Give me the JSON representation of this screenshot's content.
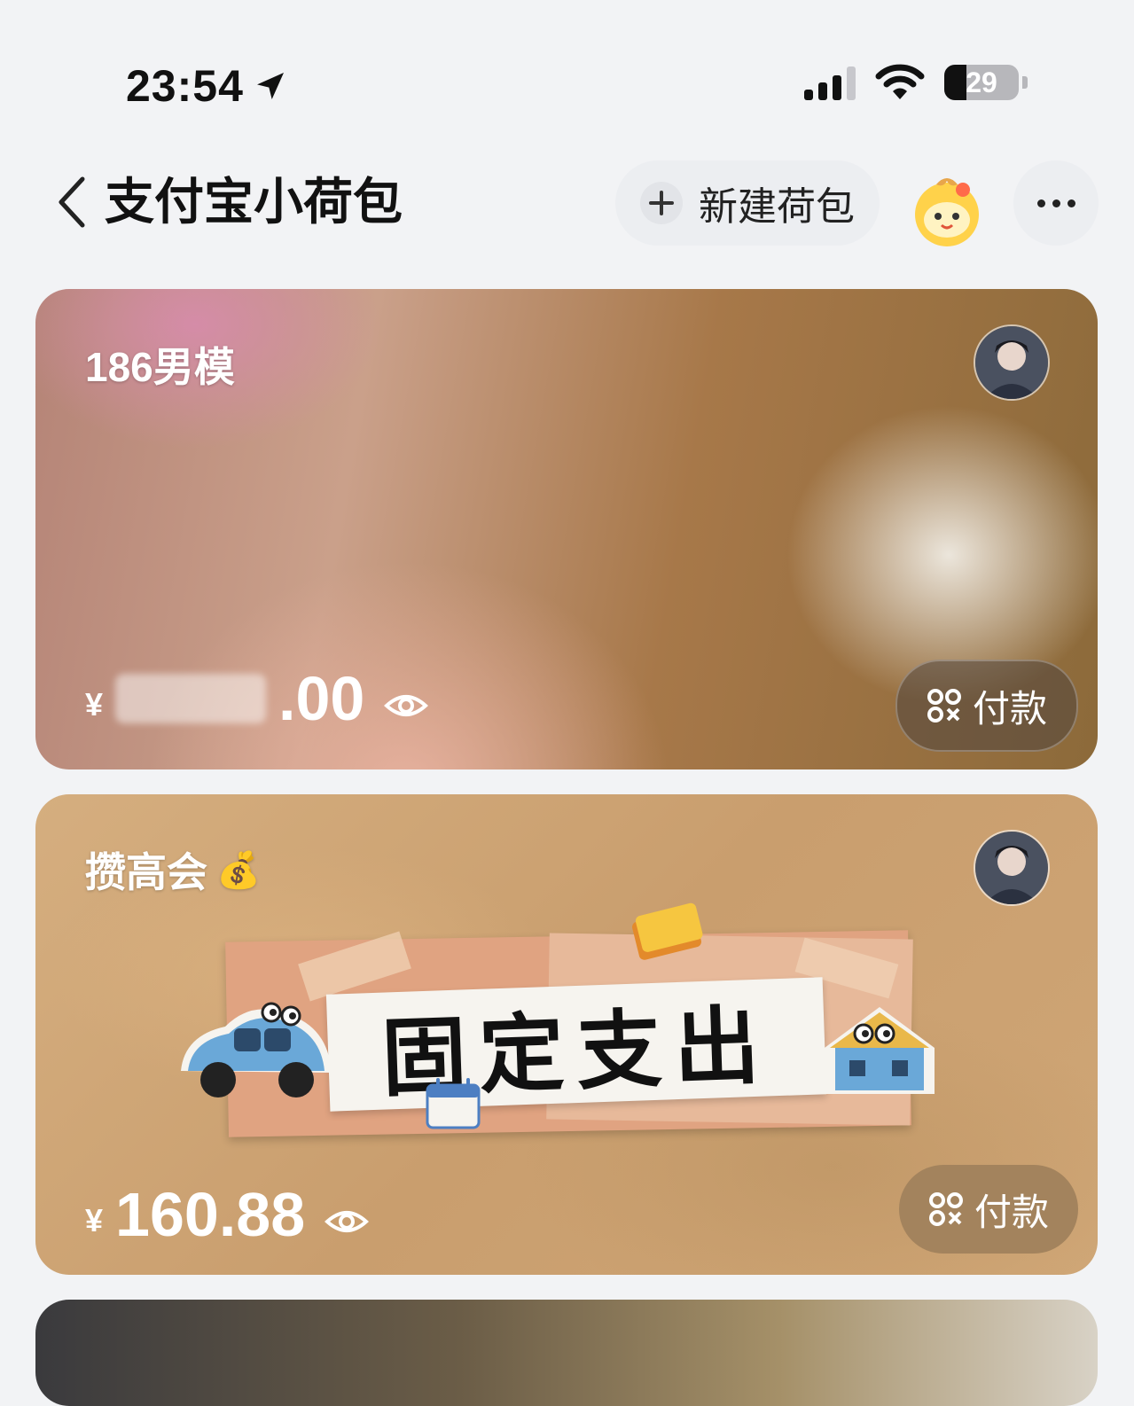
{
  "status_bar": {
    "time": "23:54",
    "battery": "29"
  },
  "header": {
    "title": "支付宝小荷包",
    "new_wallet_label": "新建荷包"
  },
  "cards": [
    {
      "name": "186男模",
      "currency": "¥",
      "amount": ".00",
      "pay_label": "付款"
    },
    {
      "name": "攒高会",
      "name_emoji": "💰",
      "currency": "¥",
      "amount": "160.88",
      "pay_label": "付款",
      "sticker_text": "固定支出"
    }
  ]
}
